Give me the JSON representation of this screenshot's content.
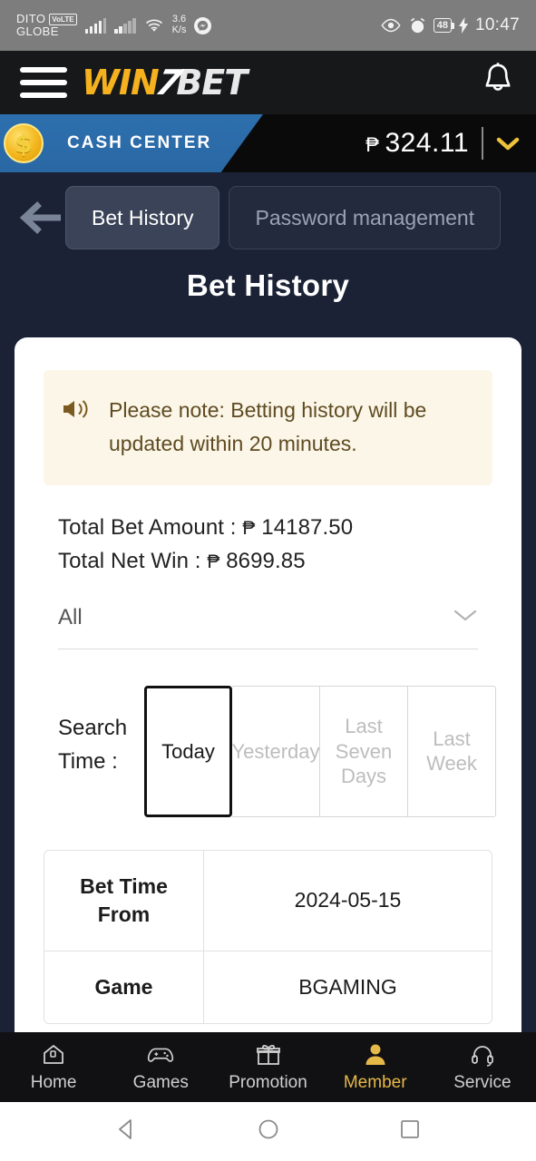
{
  "status_bar": {
    "carrier_primary": "DITO",
    "volte_badge": "VoLTE",
    "carrier_secondary": "GLOBE",
    "network_speed": "3.6\nK/s",
    "speed_value": "3.6",
    "speed_unit": "K/s",
    "battery_percent": "48",
    "clock": "10:47",
    "icons": [
      "signal-bars-icon",
      "signal-bars-icon",
      "wifi-icon",
      "messenger-icon",
      "eye-icon",
      "alarm-clock-icon",
      "battery-icon",
      "charging-bolt-icon"
    ]
  },
  "header": {
    "menu_icon": "hamburger-menu-icon",
    "logo_win": "WIN",
    "logo_slash": "7",
    "logo_bet": "BET",
    "bell_icon": "notification-bell-icon"
  },
  "cash_center": {
    "label": "CASH CENTER",
    "coin_symbol": "$",
    "currency_symbol": "₱",
    "balance": "324.11",
    "caret": "⌄"
  },
  "tabs": {
    "back_icon": "back-arrow-icon",
    "items": [
      {
        "label": "Bet History",
        "active": true
      },
      {
        "label": "Password management",
        "active": false
      }
    ]
  },
  "page": {
    "title": "Bet History"
  },
  "notice": {
    "icon": "speaker-announcement-icon",
    "text": "Please note: Betting history will be updated within 20 minutes."
  },
  "totals": {
    "bet_amount_label": "Total Bet Amount :",
    "bet_amount_currency": "₱",
    "bet_amount_value": "14187.50",
    "net_win_label": "Total Net Win :",
    "net_win_currency": "₱",
    "net_win_value": "8699.85"
  },
  "filter_select": {
    "selected": "All",
    "chevron": "chevron-down-icon"
  },
  "search_time": {
    "label": "Search Time :",
    "options": [
      {
        "label": "Today",
        "selected": true
      },
      {
        "label": "Yesterday",
        "selected": false
      },
      {
        "label": "Last Seven Days",
        "selected": false
      },
      {
        "label": "Last Week",
        "selected": false
      }
    ]
  },
  "bet_table": {
    "rows": [
      {
        "key": "Bet Time From",
        "value": "2024-05-15"
      },
      {
        "key": "Game",
        "value": "BGAMING"
      }
    ]
  },
  "bottom_nav": {
    "items": [
      {
        "label": "Home",
        "icon": "home-icon",
        "active": false
      },
      {
        "label": "Games",
        "icon": "gamepad-icon",
        "active": false
      },
      {
        "label": "Promotion",
        "icon": "gift-icon",
        "active": false
      },
      {
        "label": "Member",
        "icon": "user-icon",
        "active": true
      },
      {
        "label": "Service",
        "icon": "headset-icon",
        "active": false
      }
    ]
  },
  "soft_keys": {
    "back": "back-triangle-icon",
    "home": "home-circle-icon",
    "recents": "recents-square-icon"
  },
  "colors": {
    "brand_gold": "#f5b11e",
    "accent_blue": "#2d6fae",
    "page_bg": "#1b2236",
    "notice_bg": "#fbf6e7",
    "member_active": "#e5b947"
  }
}
